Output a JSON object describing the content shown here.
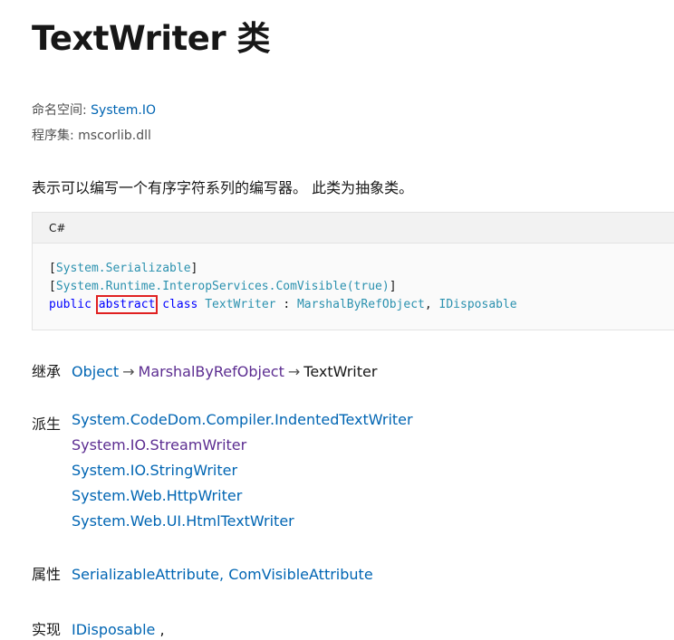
{
  "title": "TextWriter 类",
  "namespace": {
    "label": "命名空间:",
    "value": "System.IO"
  },
  "assembly": {
    "label": "程序集:",
    "value": "mscorlib.dll"
  },
  "summary": "表示可以编写一个有序字符系列的编写器。 此类为抽象类。",
  "code": {
    "language": "C#",
    "line1": "System.Serializable",
    "line2": "System.Runtime.InteropServices.ComVisible(true)",
    "kw_public": "public",
    "kw_abstract": "abstract",
    "kw_class": "class",
    "type_name": "TextWriter",
    "colon": ":",
    "base": "MarshalByRefObject",
    "comma": ",",
    "iface": "IDisposable",
    "highlight_color": "#e02020"
  },
  "inheritance": {
    "label": "继承",
    "items": [
      "Object",
      "MarshalByRefObject",
      "TextWriter"
    ],
    "arrow": "→"
  },
  "derived": {
    "label": "派生",
    "items": [
      "System.CodeDom.Compiler.IndentedTextWriter",
      "System.IO.StreamWriter",
      "System.IO.StringWriter",
      "System.Web.HttpWriter",
      "System.Web.UI.HtmlTextWriter"
    ]
  },
  "attributes": {
    "label": "属性",
    "item1": "SerializableAttribute",
    "sep": ",",
    "item2": "ComVisibleAttribute"
  },
  "implements": {
    "label": "实现",
    "item1": "IDisposable",
    "sep": ","
  },
  "colors": {
    "link": "#0065b3",
    "visited": "#5c2d91",
    "text": "#171717"
  }
}
